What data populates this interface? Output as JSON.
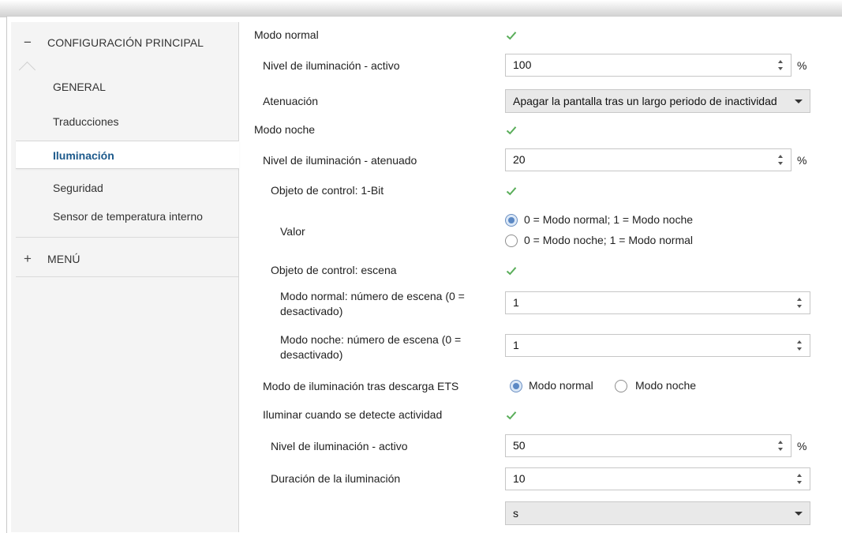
{
  "sidebar": {
    "main_section": {
      "sign": "−",
      "label": "CONFIGURACIÓN PRINCIPAL"
    },
    "items": [
      {
        "label": "GENERAL"
      },
      {
        "label": "Traducciones"
      },
      {
        "label": "Iluminación"
      },
      {
        "label": "Seguridad"
      },
      {
        "label": "Sensor de temperatura interno"
      }
    ],
    "menu_section": {
      "sign": "+",
      "label": "MENÚ"
    }
  },
  "colors": {
    "accent": "#1d5a8c",
    "check": "#5aae5a",
    "radio": "#5b88c4"
  },
  "form": {
    "modo_normal": {
      "label": "Modo normal",
      "checked": true
    },
    "nivel_activo": {
      "label": "Nivel de iluminación - activo",
      "value": "100",
      "unit": "%"
    },
    "atenuacion": {
      "label": "Atenuación",
      "value": "Apagar la pantalla tras un largo periodo de inactividad"
    },
    "modo_noche": {
      "label": "Modo noche",
      "checked": true
    },
    "nivel_atenuado": {
      "label": "Nivel de iluminación - atenuado",
      "value": "20",
      "unit": "%"
    },
    "obj_1bit": {
      "label": "Objeto de control: 1-Bit",
      "checked": true
    },
    "valor": {
      "label": "Valor",
      "options": [
        "0 = Modo normal; 1 = Modo noche",
        "0 = Modo noche; 1 = Modo normal"
      ],
      "selected": 0
    },
    "obj_escena": {
      "label": "Objeto de control: escena",
      "checked": true
    },
    "escena_normal": {
      "label": "Modo normal: número de escena (0 = desactivado)",
      "value": "1"
    },
    "escena_noche": {
      "label": "Modo noche: número de escena (0 = desactivado)",
      "value": "1"
    },
    "modo_ets": {
      "label": "Modo de iluminación tras descarga ETS",
      "options": [
        "Modo normal",
        "Modo noche"
      ],
      "selected": 0
    },
    "iluminar_actividad": {
      "label": "Iluminar cuando se detecte actividad",
      "checked": true
    },
    "nivel_activo2": {
      "label": "Nivel de iluminación - activo",
      "value": "50",
      "unit": "%"
    },
    "duracion": {
      "label": "Duración de la iluminación",
      "value": "10",
      "unit_select": "s"
    }
  }
}
